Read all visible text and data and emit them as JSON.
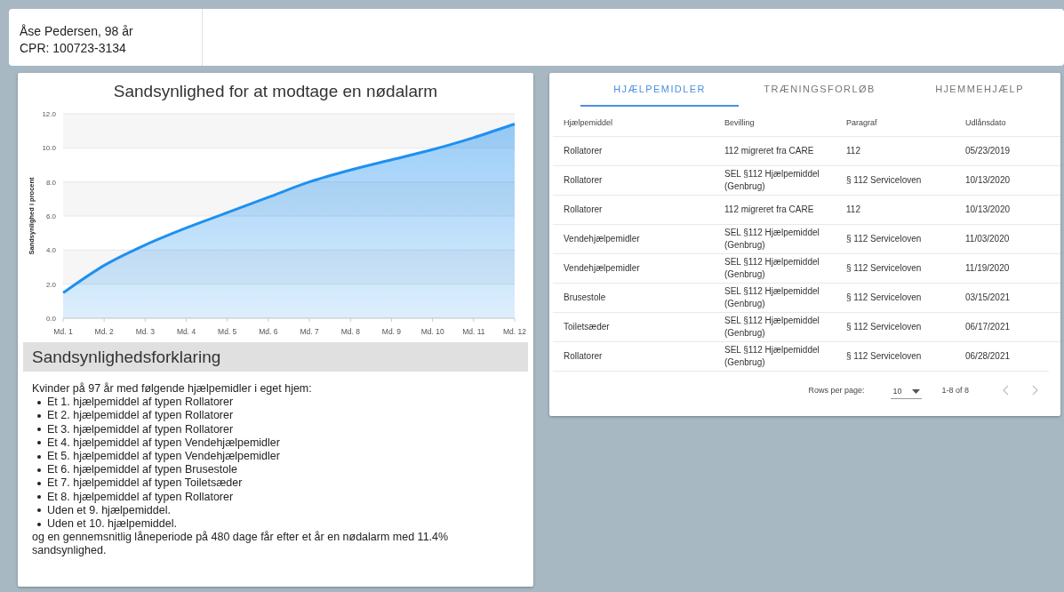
{
  "patient": {
    "name": "Åse Pedersen, 98 år",
    "cpr": "CPR: 100723-3134"
  },
  "chart_panel": {
    "title": "Sandsynlighed for at modtage en nødalarm",
    "chart_data": {
      "type": "area",
      "ylabel": "Sandsynlighed i procent",
      "categories": [
        "Md. 1",
        "Md. 2",
        "Md. 3",
        "Md. 4",
        "Md. 5",
        "Md. 6",
        "Md. 7",
        "Md. 8",
        "Md. 9",
        "Md. 10",
        "Md. 11",
        "Md. 12"
      ],
      "grid": true,
      "series": [
        {
          "color": "#1e90f0",
          "values": [
            1.5,
            3.1,
            4.3,
            5.3,
            6.2,
            7.1,
            8.0,
            8.7,
            9.3,
            9.9,
            10.6,
            11.4
          ]
        }
      ],
      "ylim": [
        0,
        12
      ],
      "yticks": [
        {
          "value": 0,
          "label": "0.0"
        },
        {
          "value": 2,
          "label": "2.0"
        },
        {
          "value": 4,
          "label": "4.0"
        },
        {
          "value": 6,
          "label": "6.0"
        },
        {
          "value": 8,
          "label": "8.0"
        },
        {
          "value": 10,
          "label": "10.0"
        },
        {
          "value": 12,
          "label": "12.0"
        }
      ]
    }
  },
  "explanation": {
    "heading": "Sandsynlighedsforklaring",
    "intro": "Kvinder på 97 år med følgende hjælpemidler i eget hjem:",
    "items": [
      "Et 1. hjælpemiddel af typen Rollatorer",
      "Et 2. hjælpemiddel af typen Rollatorer",
      "Et 3. hjælpemiddel af typen Rollatorer",
      "Et 4. hjælpemiddel af typen Vendehjælpemidler",
      "Et 5. hjælpemiddel af typen Vendehjælpemidler",
      "Et 6. hjælpemiddel af typen Brusestole",
      "Et 7. hjælpemiddel af typen Toiletsæder",
      "Et 8. hjælpemiddel af typen Rollatorer",
      "Uden et 9. hjælpemiddel.",
      "Uden et 10. hjælpemiddel."
    ],
    "conclusion": "og en gennemsnitlig låneperiode på 480 dage får efter et år en nødalarm med 11.4% sandsynlighed."
  },
  "tabs": [
    {
      "label": "HJÆLPEMIDLER",
      "selected": true
    },
    {
      "label": "TRÆNINGSFORLØB",
      "selected": false
    },
    {
      "label": "HJEMMEHJÆLP",
      "selected": false
    }
  ],
  "table": {
    "columns": [
      "Hjælpemiddel",
      "Bevilling",
      "Paragraf",
      "Udlånsdato"
    ],
    "rows": [
      [
        "Rollatorer",
        "112 migreret fra CARE",
        "112",
        "05/23/2019"
      ],
      [
        "Rollatorer",
        "SEL §112 Hjælpemiddel (Genbrug)",
        "§ 112 Serviceloven",
        "10/13/2020"
      ],
      [
        "Rollatorer",
        "112 migreret fra CARE",
        "112",
        "10/13/2020"
      ],
      [
        "Vendehjælpemidler",
        "SEL §112 Hjælpemiddel (Genbrug)",
        "§ 112 Serviceloven",
        "11/03/2020"
      ],
      [
        "Vendehjælpemidler",
        "SEL §112 Hjælpemiddel (Genbrug)",
        "§ 112 Serviceloven",
        "11/19/2020"
      ],
      [
        "Brusestole",
        "SEL §112 Hjælpemiddel (Genbrug)",
        "§ 112 Serviceloven",
        "03/15/2021"
      ],
      [
        "Toiletsæder",
        "SEL §112 Hjælpemiddel (Genbrug)",
        "§ 112 Serviceloven",
        "06/17/2021"
      ],
      [
        "Rollatorer",
        "SEL §112 Hjælpemiddel (Genbrug)",
        "§ 112 Serviceloven",
        "06/28/2021"
      ]
    ]
  },
  "pagination": {
    "rows_per_page_label": "Rows per page:",
    "rows_per_page": "10",
    "range": "1-8 of 8",
    "prev_disabled": true,
    "next_disabled": true
  }
}
